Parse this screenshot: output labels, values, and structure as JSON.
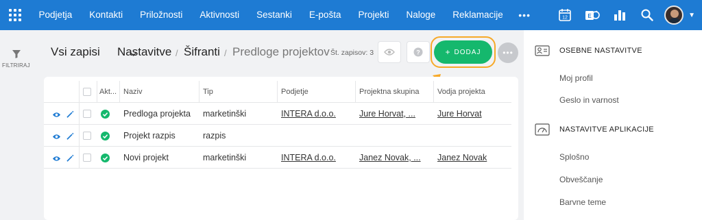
{
  "nav": {
    "items": [
      "Podjetja",
      "Kontakti",
      "Priložnosti",
      "Aktivnosti",
      "Sestanki",
      "E-pošta",
      "Projekti",
      "Naloge",
      "Reklamacije"
    ],
    "more": "•••",
    "calendar_day": "12",
    "accent": "#1e7bd3"
  },
  "left": {
    "filter_label": "FILTRIRAJ"
  },
  "header": {
    "view": "Vsi zapisi",
    "crumb1": "Nastavitve",
    "sep": "/",
    "crumb2": "Šifranti",
    "crumb3": "Predloge projektov",
    "count": "Št. zapisov: 3",
    "add_label": "DODAJ",
    "add_plus": "+",
    "add_color": "#15b86d",
    "highlight_color": "#f7a928"
  },
  "table": {
    "columns": [
      "Akt...",
      "Naziv",
      "Tip",
      "Podjetje",
      "Projektna skupina",
      "Vodja projekta"
    ],
    "rows": [
      {
        "naziv": "Predloga projekta",
        "tip": "marketinški",
        "podjetje": "INTERA d.o.o.",
        "skupina": "Jure Horvat, ...",
        "vodja": "Jure Horvat"
      },
      {
        "naziv": "Projekt razpis",
        "tip": "razpis",
        "podjetje": "",
        "skupina": "",
        "vodja": ""
      },
      {
        "naziv": "Novi projekt",
        "tip": "marketinški",
        "podjetje": "INTERA d.o.o.",
        "skupina": "Janez Novak, ...",
        "vodja": "Janez Novak"
      }
    ]
  },
  "right_panel": {
    "section1": "OSEBNE NASTAVITVE",
    "section1_items": [
      "Moj profil",
      "Geslo in varnost"
    ],
    "section2": "NASTAVITVE APLIKACIJE",
    "section2_items": [
      "Splošno",
      "Obveščanje",
      "Barvne teme"
    ]
  }
}
